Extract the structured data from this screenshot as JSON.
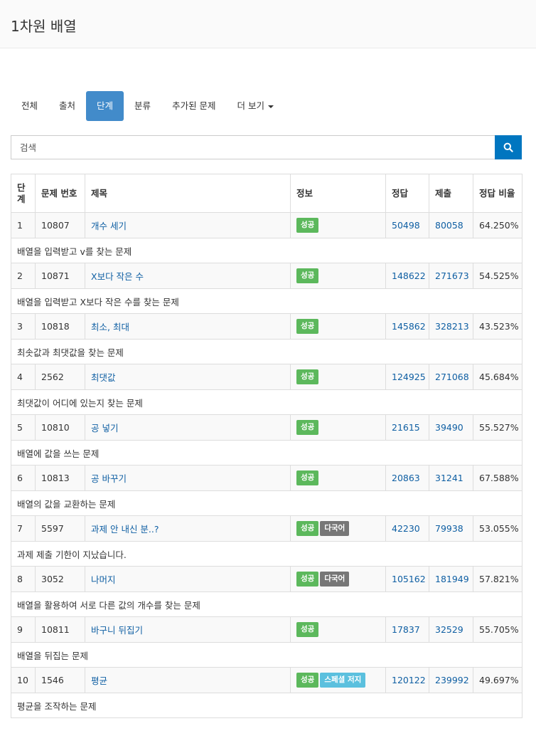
{
  "page": {
    "title": "1차원 배열"
  },
  "tabs": [
    {
      "label": "전체",
      "active": false
    },
    {
      "label": "출처",
      "active": false
    },
    {
      "label": "단계",
      "active": true
    },
    {
      "label": "분류",
      "active": false
    },
    {
      "label": "추가된 문제",
      "active": false
    },
    {
      "label": "더 보기",
      "active": false
    }
  ],
  "search": {
    "placeholder": "검색",
    "button_icon": "search-icon"
  },
  "colors": {
    "active_tab": "#428bca",
    "search_button": "#0076c0",
    "link": "#0f5fa3",
    "success": "#5cb85c",
    "multilang": "#777777",
    "special": "#5bc0de"
  },
  "table": {
    "headers": [
      "단계",
      "문제 번호",
      "제목",
      "정보",
      "정답",
      "제출",
      "정답 비율"
    ],
    "rows": [
      {
        "step": "1",
        "id": "10807",
        "title": "개수 세기",
        "badges": [
          "성공"
        ],
        "correct": "50498",
        "submit": "80058",
        "ratio": "64.250%",
        "desc": "배열을 입력받고 v를 찾는 문제"
      },
      {
        "step": "2",
        "id": "10871",
        "title": "X보다 작은 수",
        "badges": [
          "성공"
        ],
        "correct": "148622",
        "submit": "271673",
        "ratio": "54.525%",
        "desc": "배열을 입력받고 X보다 작은 수를 찾는 문제"
      },
      {
        "step": "3",
        "id": "10818",
        "title": "최소, 최대",
        "badges": [
          "성공"
        ],
        "correct": "145862",
        "submit": "328213",
        "ratio": "43.523%",
        "desc": "최솟값과 최댓값을 찾는 문제"
      },
      {
        "step": "4",
        "id": "2562",
        "title": "최댓값",
        "badges": [
          "성공"
        ],
        "correct": "124925",
        "submit": "271068",
        "ratio": "45.684%",
        "desc": "최댓값이 어디에 있는지 찾는 문제"
      },
      {
        "step": "5",
        "id": "10810",
        "title": "공 넣기",
        "badges": [
          "성공"
        ],
        "correct": "21615",
        "submit": "39490",
        "ratio": "55.527%",
        "desc": "배열에 값을 쓰는 문제"
      },
      {
        "step": "6",
        "id": "10813",
        "title": "공 바꾸기",
        "badges": [
          "성공"
        ],
        "correct": "20863",
        "submit": "31241",
        "ratio": "67.588%",
        "desc": "배열의 값을 교환하는 문제"
      },
      {
        "step": "7",
        "id": "5597",
        "title": "과제 안 내신 분..?",
        "badges": [
          "성공",
          "다국어"
        ],
        "correct": "42230",
        "submit": "79938",
        "ratio": "53.055%",
        "desc": "과제 제출 기한이 지났습니다."
      },
      {
        "step": "8",
        "id": "3052",
        "title": "나머지",
        "badges": [
          "성공",
          "다국어"
        ],
        "correct": "105162",
        "submit": "181949",
        "ratio": "57.821%",
        "desc": "배열을 활용하여 서로 다른 값의 개수를 찾는 문제"
      },
      {
        "step": "9",
        "id": "10811",
        "title": "바구니 뒤집기",
        "badges": [
          "성공"
        ],
        "correct": "17837",
        "submit": "32529",
        "ratio": "55.705%",
        "desc": "배열을 뒤집는 문제"
      },
      {
        "step": "10",
        "id": "1546",
        "title": "평균",
        "badges": [
          "성공",
          "스페셜 저지"
        ],
        "correct": "120122",
        "submit": "239992",
        "ratio": "49.697%",
        "desc": "평균을 조작하는 문제"
      }
    ]
  }
}
